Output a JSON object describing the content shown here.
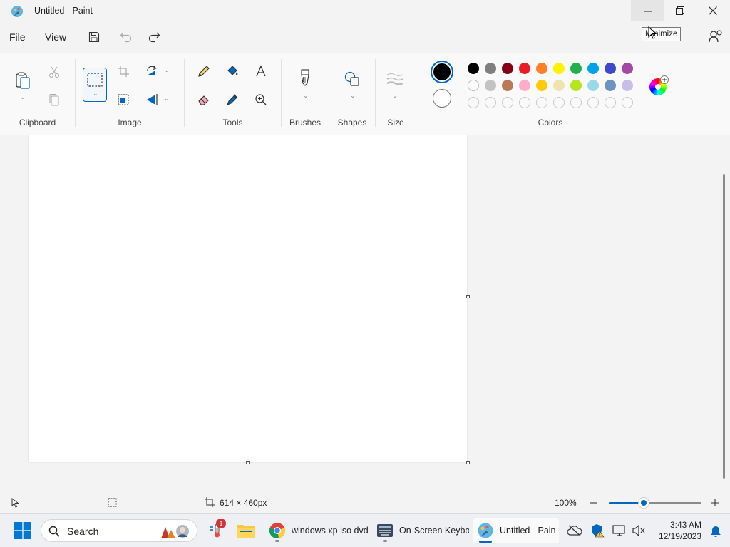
{
  "window": {
    "title": "Untitled - Paint",
    "tooltip": "Minimize"
  },
  "menu": {
    "file": "File",
    "view": "View"
  },
  "ribbon": {
    "groups": {
      "clipboard": "Clipboard",
      "image": "Image",
      "tools": "Tools",
      "brushes": "Brushes",
      "shapes": "Shapes",
      "size": "Size",
      "colors": "Colors"
    },
    "primary_color": "#000000",
    "secondary_color": "#ffffff",
    "palette_row1": [
      "#000000",
      "#7f7f7f",
      "#880015",
      "#ed1c24",
      "#ff7f27",
      "#fff200",
      "#22b14c",
      "#00a2e8",
      "#3f48cc",
      "#a349a4"
    ],
    "palette_row2": [
      "#ffffff",
      "#c3c3c3",
      "#b97a57",
      "#ffaec9",
      "#ffc90e",
      "#efe4b0",
      "#b5e61d",
      "#99d9ea",
      "#7092be",
      "#c8bfe7"
    ]
  },
  "status": {
    "canvas_size": "614 × 460px",
    "zoom": "100%",
    "zoom_level": 0.38
  },
  "taskbar": {
    "search": "Search",
    "notification_count": "1",
    "apps": {
      "chrome": "windows xp iso dvd",
      "osk": "On-Screen Keyboa",
      "paint": "Untitled - Pain"
    },
    "time": "3:43 AM",
    "date": "12/19/2023"
  }
}
